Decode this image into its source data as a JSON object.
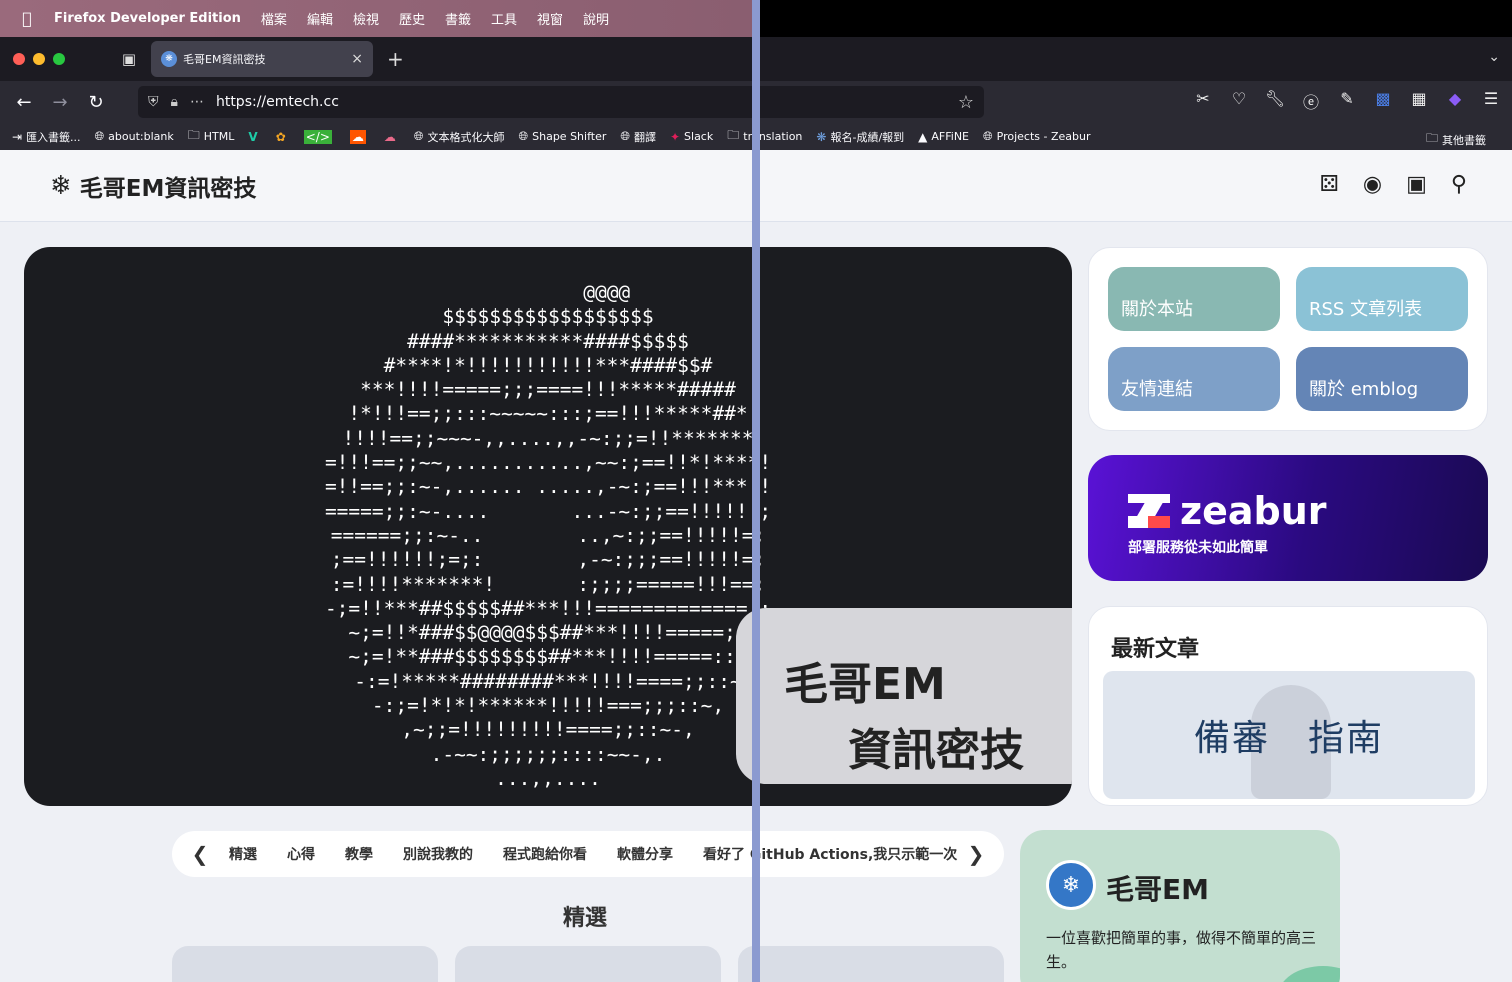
{
  "menubar": {
    "apple": "",
    "app_name": "Firefox Developer Edition",
    "items": [
      "檔案",
      "編輯",
      "檢視",
      "歷史",
      "書籤",
      "工具",
      "視窗",
      "說明"
    ]
  },
  "tab": {
    "title": "毛哥EM資訊密技",
    "close": "×",
    "new_tab": "+",
    "list_all_tabs": "⌄"
  },
  "navbar": {
    "back": "←",
    "forward": "→",
    "reload": "↻",
    "url": "https://emtech.cc"
  },
  "bookmarks": {
    "items": [
      {
        "label": "匯入書籤...",
        "icon": "import-icon"
      },
      {
        "label": "about:blank",
        "icon": "globe-icon"
      },
      {
        "label": "HTML",
        "icon": "folder-icon"
      },
      {
        "label": "",
        "icon": "vuetify-icon"
      },
      {
        "label": "",
        "icon": "colorful-icon"
      },
      {
        "label": "",
        "icon": "codepen-icon"
      },
      {
        "label": "",
        "icon": "soundcloud-icon"
      },
      {
        "label": "",
        "icon": "cloud-icon"
      },
      {
        "label": "文本格式化大師",
        "icon": "globe-icon"
      },
      {
        "label": "Shape Shifter",
        "icon": "globe-icon"
      },
      {
        "label": "翻譯",
        "icon": "globe-icon"
      },
      {
        "label": "Slack",
        "icon": "slack-icon"
      },
      {
        "label": "translation",
        "icon": "folder-icon"
      },
      {
        "label": "報名-成績/報到",
        "icon": "badge-icon"
      },
      {
        "label": "AFFiNE",
        "icon": "affine-icon"
      },
      {
        "label": "Projects - Zeabur",
        "icon": "globe-icon"
      }
    ],
    "other": "其他書籤"
  },
  "site": {
    "logo_text": "毛哥EM資訊密技",
    "hero_line1": "毛哥EM",
    "hero_line2": "資訊密技",
    "links": [
      "關於本站",
      "RSS 文章列表",
      "友情連結",
      "關於 emblog"
    ],
    "zeabur_name": "zeabur",
    "zeabur_tagline": "部署服務從未如此簡單",
    "latest_title": "最新文章",
    "latest_image_text": "備審　指南",
    "categories": [
      "精選",
      "心得",
      "教學",
      "別說我教的",
      "程式跑給你看",
      "軟體分享",
      "看好了 GitHub Actions,我只示範一次"
    ],
    "featured_title": "精選",
    "profile_name": "毛哥EM",
    "profile_bio": "一位喜歡把簡單的事，做得不簡單的高三生。"
  },
  "colors": {
    "menubar": "#9a6a7c",
    "browser_dark": "#2b2a33",
    "hero_bg": "#1b1c20",
    "link1": "#89b8b2",
    "link2": "#8bc2d6",
    "link3": "#7ea0c8",
    "link4": "#6485b6",
    "zeabur_purple": "#5a12d6",
    "profile_bg": "#c3dfd0",
    "divider": "#8b9ad0"
  }
}
